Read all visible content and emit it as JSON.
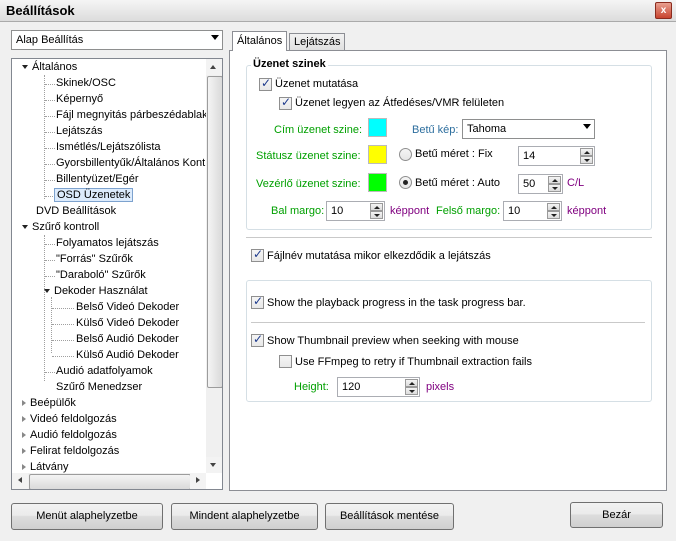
{
  "window": {
    "title": "Beállítások",
    "close_glyph": "x"
  },
  "preset": {
    "selected": "Alap Beállítás"
  },
  "tree": {
    "items": [
      "Általános",
      "Skinek/OSC",
      "Képernyő",
      "Fájl megnyitás párbeszédablak",
      "Lejátszás",
      "Ismétlés/Lejátszólista",
      "Gyorsbillentyűk/Általános Kontr",
      "Billentyüzet/Egér",
      "OSD Üzenetek",
      "DVD Beállítások",
      "Szűrő kontroll",
      "Folyamatos lejátszás",
      "\"Forrás\" Szűrők",
      "\"Daraboló\" Szűrők",
      "Dekoder Használat",
      "Belső Videó Dekoder",
      "Külső Videó Dekoder",
      "Belső Audió Dekoder",
      "Külső Audió Dekoder",
      "Audió adatfolyamok",
      "Szűrő Menedzser",
      "Beépülők",
      "Videó feldolgozás",
      "Audió feldolgozás",
      "Felirat feldolgozás",
      "Látvány"
    ]
  },
  "tabs": {
    "general": "Általános",
    "playback": "Lejátszás"
  },
  "osd_colors": {
    "group_title": "Üzenet szinek",
    "show_messages": "Üzenet mutatása",
    "overlay_vmr": "Üzenet legyen az Átfedéses/VMR felületen",
    "title_color_label": "Cím üzenet szine:",
    "status_color_label": "Státusz üzenet szine:",
    "control_color_label": "Vezérlő üzenet szine:",
    "title_color": "#00ffff",
    "status_color": "#ffff00",
    "control_color": "#00ff00",
    "font_label": "Betű kép:",
    "font_value": "Tahoma",
    "fixed_size_label": "Betű méret : Fix",
    "fixed_size_value": "14",
    "auto_size_label": "Betű  méret : Auto",
    "auto_size_value": "50",
    "auto_size_unit": "C/L",
    "left_margin_label": "Bal margo:",
    "left_margin_value": "10",
    "left_margin_unit": "képpont",
    "top_margin_label": "Felső margo:",
    "top_margin_value": "10",
    "top_margin_unit": "képpont"
  },
  "filename_on_start": "Fájlnév mutatása mikor elkezdődik a lejátszás",
  "taskbar_progress": "Show the playback progress in the task progress bar.",
  "thumbnail": {
    "show_preview": "Show Thumbnail preview when seeking with mouse",
    "ffmpeg_retry": "Use FFmpeg to retry if Thumbnail extraction fails",
    "height_label": "Height:",
    "height_value": "120",
    "height_unit": "pixels"
  },
  "buttons": {
    "reset_menu": "Menüt alaphelyzetbe",
    "reset_all": "Mindent alaphelyzetbe",
    "save": "Beállítások mentése",
    "close": "Bezár"
  },
  "colors": {
    "accent_green": "#00a000",
    "unit_purple": "#800080"
  }
}
